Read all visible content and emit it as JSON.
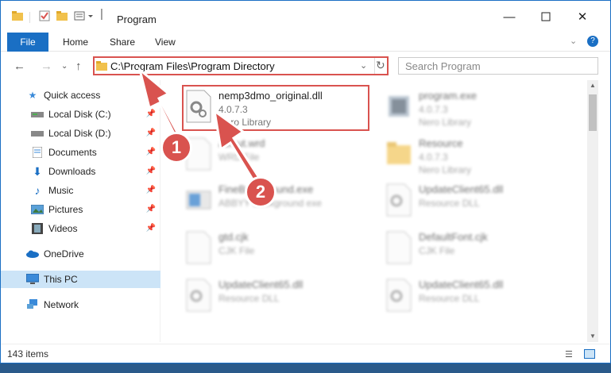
{
  "title": "Program",
  "ribbon": {
    "tabs": [
      "File",
      "Home",
      "Share",
      "View"
    ]
  },
  "address": {
    "path": "C:\\Program Files\\Program Directory"
  },
  "search": {
    "placeholder": "Search Program"
  },
  "sidebar": {
    "items": [
      {
        "label": "Quick access",
        "icon": "star-icon"
      },
      {
        "label": "Local Disk (C:)",
        "icon": "drive-icon"
      },
      {
        "label": "Local Disk (D:)",
        "icon": "drive-icon"
      },
      {
        "label": "Documents",
        "icon": "documents-icon"
      },
      {
        "label": "Downloads",
        "icon": "download-icon"
      },
      {
        "label": "Music",
        "icon": "music-icon"
      },
      {
        "label": "Pictures",
        "icon": "pictures-icon"
      },
      {
        "label": "Videos",
        "icon": "videos-icon"
      },
      {
        "label": "OneDrive",
        "icon": "cloud-icon"
      },
      {
        "label": "This PC",
        "icon": "pc-icon"
      },
      {
        "label": "Network",
        "icon": "network-icon"
      }
    ]
  },
  "files": [
    {
      "name": "nemp3dmo_original.dll",
      "line1": "4.0.7.3",
      "line2": "Nero Library",
      "icon": "gear-file-icon"
    },
    {
      "name": "program.exe",
      "line1": "4.0.7.3",
      "line2": "Nero Library",
      "icon": "app-icon"
    },
    {
      "name": "About.wrd",
      "line1": "WRD File",
      "line2": "",
      "icon": "file-icon"
    },
    {
      "name": "Resource",
      "line1": "4.0.7.3",
      "line2": "Nero Library",
      "icon": "folder-icon"
    },
    {
      "name": "FineBackground.exe",
      "line1": "ABBYY Background exe",
      "line2": "",
      "icon": "app-icon"
    },
    {
      "name": "UpdateClient65.dll",
      "line1": "Resource DLL",
      "line2": "",
      "icon": "gear-file-icon"
    },
    {
      "name": "gtd.cjk",
      "line1": "CJK File",
      "line2": "",
      "icon": "file-icon"
    },
    {
      "name": "DefaultFont.cjk",
      "line1": "CJK File",
      "line2": "",
      "icon": "file-icon"
    },
    {
      "name": "UpdateClient65.dll",
      "line1": "Resource DLL",
      "line2": "",
      "icon": "gear-file-icon"
    },
    {
      "name": "UpdateClient65.dll",
      "line1": "Resource DLL",
      "line2": "",
      "icon": "gear-file-icon"
    }
  ],
  "status": {
    "count": "143 items"
  },
  "annotations": {
    "step1": "1",
    "step2": "2"
  },
  "colors": {
    "accent": "#1a6fc4",
    "highlight": "#d9534f"
  }
}
